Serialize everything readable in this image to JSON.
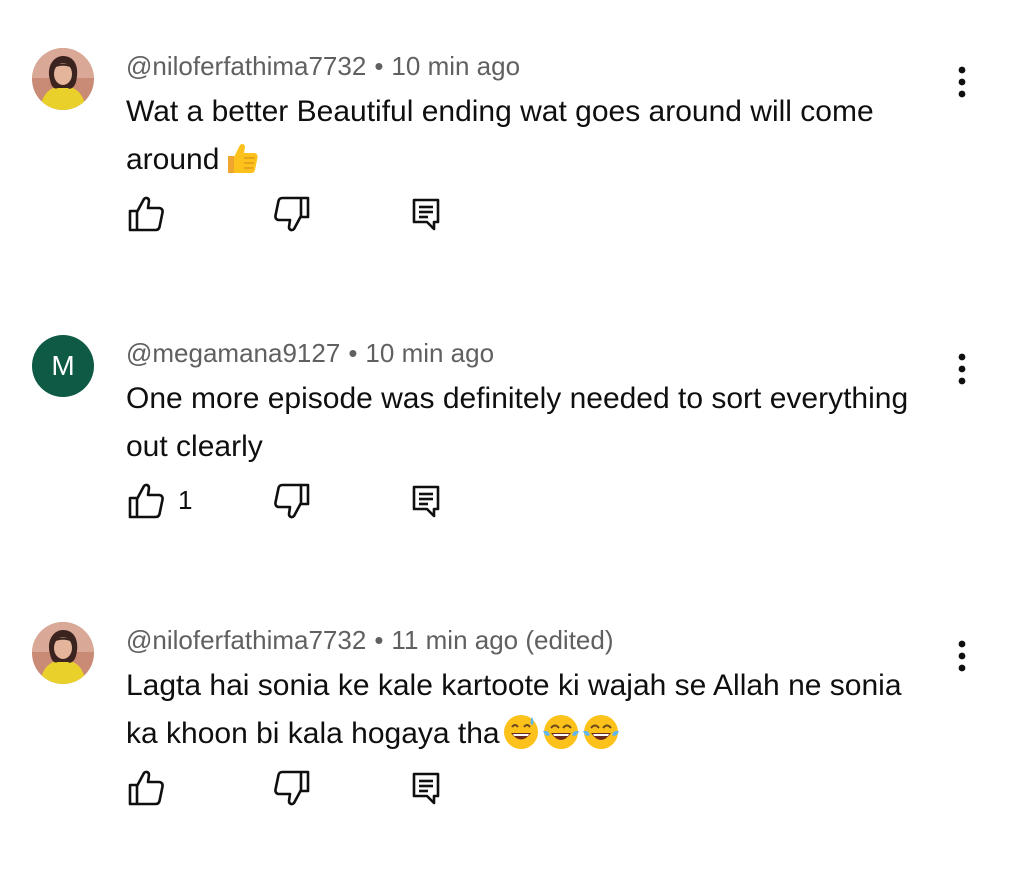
{
  "comments": [
    {
      "author": "@niloferfathima7732",
      "separator": "•",
      "time": "10 min ago",
      "text": "Wat a better Beautiful ending wat goes around will come around",
      "emojis": [
        "thumbs-up-emoji"
      ],
      "avatar": "profile-photo",
      "likes": ""
    },
    {
      "author": "@megamana9127",
      "separator": "•",
      "time": "10 min ago",
      "text": "One more episode was definitely needed to sort everything out clearly",
      "emojis": [],
      "avatar_letter": "M",
      "avatar_color": "#0e5a45",
      "likes": "1"
    },
    {
      "author": "@niloferfathima7732",
      "separator": "•",
      "time": "11 min ago (edited)",
      "text": "Lagta hai sonia ke kale kartoote ki wajah se Allah ne sonia ka khoon bi kala hogaya tha",
      "emojis": [
        "sweat-smile-emoji",
        "tears-of-joy-emoji",
        "tears-of-joy-emoji"
      ],
      "avatar": "profile-photo",
      "likes": ""
    }
  ],
  "icons": {
    "like": "thumb-up-outline-icon",
    "dislike": "thumb-down-outline-icon",
    "reply": "comment-icon",
    "more": "more-vert-icon"
  },
  "colors": {
    "text": "#0f0f0f",
    "meta": "#606060",
    "avatar_m": "#0e5a45"
  }
}
